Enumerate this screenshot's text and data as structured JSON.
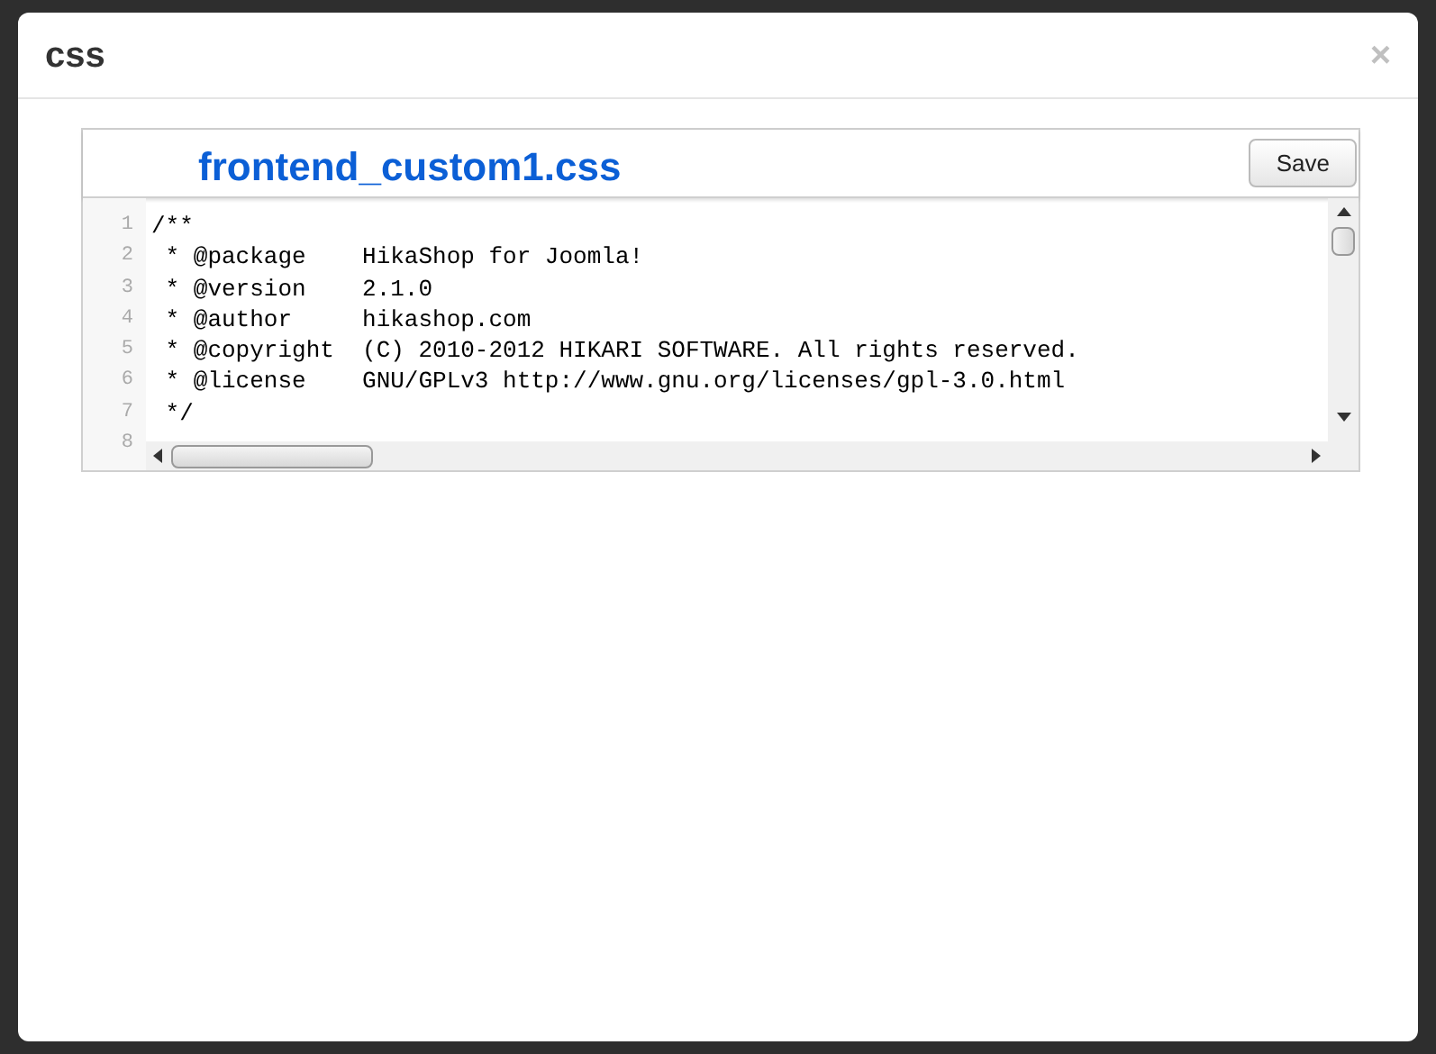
{
  "dialog": {
    "title": "css",
    "close": "×"
  },
  "editor": {
    "file_name": "frontend_custom1.css",
    "save_button": "Save",
    "lines": [
      {
        "number": "1",
        "text": "/**"
      },
      {
        "number": "2",
        "text": " * @package    HikaShop for Joomla!"
      },
      {
        "number": "3",
        "text": " * @version    2.1.0"
      },
      {
        "number": "4",
        "text": " * @author     hikashop.com"
      },
      {
        "number": "5",
        "text": " * @copyright  (C) 2010-2012 HIKARI SOFTWARE. All rights reserved."
      },
      {
        "number": "6",
        "text": " * @license    GNU/GPLv3 http://www.gnu.org/licenses/gpl-3.0.html"
      },
      {
        "number": "7",
        "text": " */"
      },
      {
        "number": "8"
      }
    ]
  }
}
